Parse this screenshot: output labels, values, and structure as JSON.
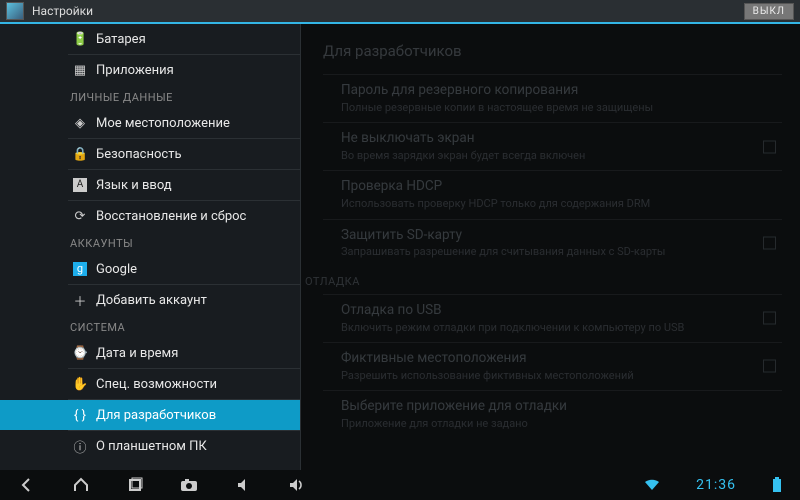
{
  "window": {
    "title": "Настройки",
    "off_button": "ВЫКЛ"
  },
  "sidebar": {
    "items": [
      {
        "icon": "🔋",
        "label": "Батарея"
      },
      {
        "icon": "▦",
        "label": "Приложения"
      }
    ],
    "cat_personal": "ЛИЧНЫЕ ДАННЫЕ",
    "personal": [
      {
        "icon": "◈",
        "label": "Мое местоположение"
      },
      {
        "icon": "🔒",
        "label": "Безопасность"
      },
      {
        "icon": "A",
        "label": "Язык и ввод"
      },
      {
        "icon": "⟳",
        "label": "Восстановление и сброс"
      }
    ],
    "cat_accounts": "АККАУНТЫ",
    "accounts": [
      {
        "icon": "g",
        "label": "Google"
      },
      {
        "icon": "＋",
        "label": "Добавить аккаунт"
      }
    ],
    "cat_system": "СИСТЕМА",
    "system": [
      {
        "icon": "⌚",
        "label": "Дата и время"
      },
      {
        "icon": "✋",
        "label": "Спец. возможности"
      },
      {
        "icon": "{ }",
        "label": "Для разработчиков"
      },
      {
        "icon": "ⓘ",
        "label": "О планшетном ПК"
      }
    ]
  },
  "detail": {
    "header": "Для разработчиков",
    "prefs1": [
      {
        "title": "Пароль для резервного копирования",
        "summary": "Полные резервные копии в настоящее время не защищены",
        "chk": false
      },
      {
        "title": "Не выключать экран",
        "summary": "Во время зарядки экран будет всегда включен",
        "chk": true
      },
      {
        "title": "Проверка HDCP",
        "summary": "Использовать проверку HDCP только для содержания DRM",
        "chk": false
      },
      {
        "title": "Защитить SD-карту",
        "summary": "Запрашивать разрешение для считывания данных с SD-карты",
        "chk": true
      }
    ],
    "section_debug": "ОТЛАДКА",
    "prefs2": [
      {
        "title": "Отладка по USB",
        "summary": "Включить режим отладки при подключении к компьютеру по USB",
        "chk": true
      },
      {
        "title": "Фиктивные местоположения",
        "summary": "Разрешить использование фиктивных местоположений",
        "chk": true
      },
      {
        "title": "Выберите приложение для отладки",
        "summary": "Приложение для отладки не задано",
        "chk": false
      }
    ]
  },
  "statusbar": {
    "time": "21:36"
  }
}
